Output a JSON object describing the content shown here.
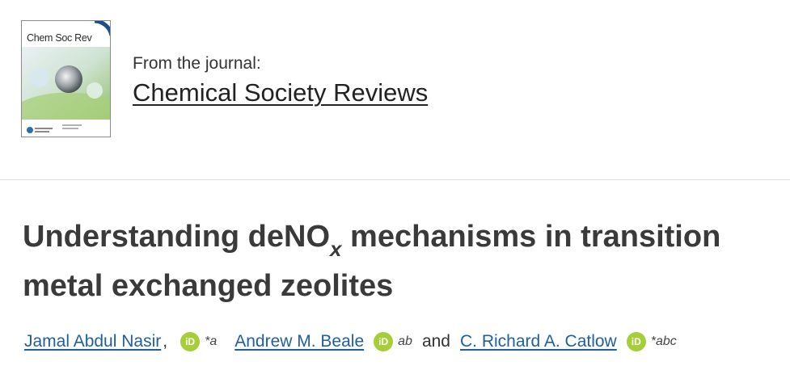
{
  "journal": {
    "cover_title": "Chem Soc Rev",
    "from_label": "From the journal:",
    "name": "Chemical Society Reviews"
  },
  "article": {
    "title_part1": "Understanding deNO",
    "title_sub": "x",
    "title_part2": " mechanisms in transition metal exchanged zeolites"
  },
  "authors": [
    {
      "name": "Jamal Abdul Nasir",
      "orcid_label": "iD",
      "affiliation": "*a"
    },
    {
      "name": "Andrew M. Beale",
      "orcid_label": "iD",
      "affiliation": "ab"
    },
    {
      "name": "C. Richard A. Catlow",
      "orcid_label": "iD",
      "affiliation": "*abc"
    }
  ],
  "separators": {
    "comma": ",",
    "and": "and"
  },
  "colors": {
    "link": "#1f5f9e",
    "orcid": "#a6ce39",
    "title": "#3a3a3a"
  }
}
